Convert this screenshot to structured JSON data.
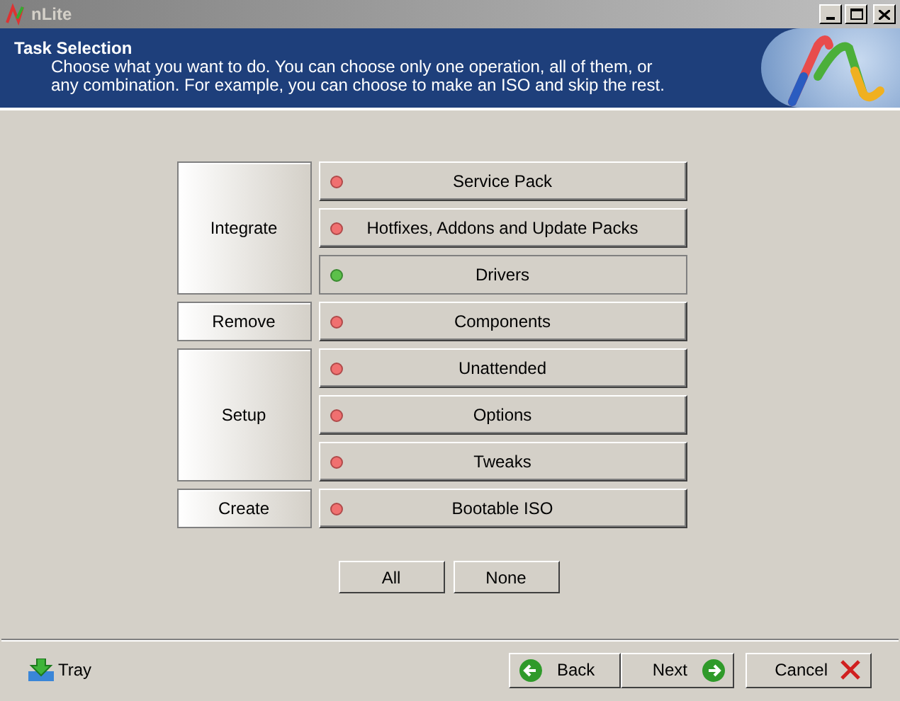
{
  "window": {
    "title": "nLite"
  },
  "header": {
    "title": "Task Selection",
    "description": "Choose what you want to do. You can choose only one operation, all of them, or any combination. For example, you can choose to make an ISO and skip the rest."
  },
  "groups": [
    {
      "label": "Integrate",
      "tasks": [
        {
          "label": "Service Pack",
          "selected": false
        },
        {
          "label": "Hotfixes, Addons and Update Packs",
          "selected": false
        },
        {
          "label": "Drivers",
          "selected": true
        }
      ]
    },
    {
      "label": "Remove",
      "tasks": [
        {
          "label": "Components",
          "selected": false
        }
      ]
    },
    {
      "label": "Setup",
      "tasks": [
        {
          "label": "Unattended",
          "selected": false
        },
        {
          "label": "Options",
          "selected": false
        },
        {
          "label": "Tweaks",
          "selected": false
        }
      ]
    },
    {
      "label": "Create",
      "tasks": [
        {
          "label": "Bootable ISO",
          "selected": false
        }
      ]
    }
  ],
  "select_buttons": [
    "All",
    "None"
  ],
  "footer": {
    "tray": "Tray",
    "back": "Back",
    "next": "Next",
    "cancel": "Cancel"
  }
}
